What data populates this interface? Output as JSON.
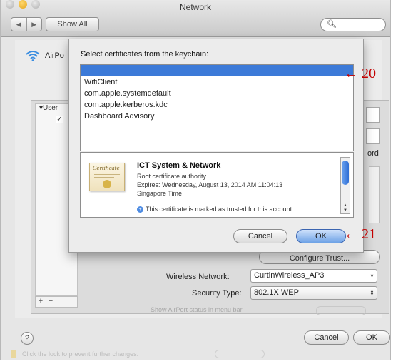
{
  "window": {
    "title": "Network",
    "nav_back": "◀",
    "nav_forward": "▶",
    "show_all": "Show All",
    "search_placeholder": "",
    "search_icon": "magnifier-icon"
  },
  "airport": {
    "label": "AirPo",
    "icon": "wifi-icon"
  },
  "background_panel": {
    "user_label": "▾User",
    "user_check": "✓",
    "ord_label": "ord",
    "configure_trust": "Configure Trust...",
    "wireless_network_label": "Wireless Network:",
    "wireless_network_value": "CurtinWireless_AP3",
    "security_type_label": "Security Type:",
    "security_type_value": "802.1X WEP",
    "add": "+",
    "remove": "−",
    "faint_row": "Show AirPort status in menu bar"
  },
  "footer": {
    "help": "?",
    "cancel": "Cancel",
    "ok": "OK",
    "faint_text": "Click the lock to prevent further changes."
  },
  "dialog": {
    "title": "Select certificates from the keychain:",
    "certificates": [
      {
        "name": "",
        "selected": true
      },
      {
        "name": "WifiClient",
        "selected": false
      },
      {
        "name": "com.apple.systemdefault",
        "selected": false
      },
      {
        "name": "com.apple.kerberos.kdc",
        "selected": false
      },
      {
        "name": "Dashboard Advisory",
        "selected": false
      }
    ],
    "detail": {
      "name": "ICT System & Network",
      "type": "Root certificate authority",
      "expires": "Expires: Wednesday, August 13, 2014 AM 11:04:13",
      "timezone": "Singapore Time",
      "trust": "This certificate is marked as trusted for this account",
      "cert_script": "Certificate"
    },
    "cancel": "Cancel",
    "ok": "OK"
  },
  "callouts": {
    "list": "← 20",
    "ok": "← 21"
  },
  "colors": {
    "selection": "#3c7ad8",
    "callout": "#c40000",
    "default_button": "#6ea2e6"
  }
}
